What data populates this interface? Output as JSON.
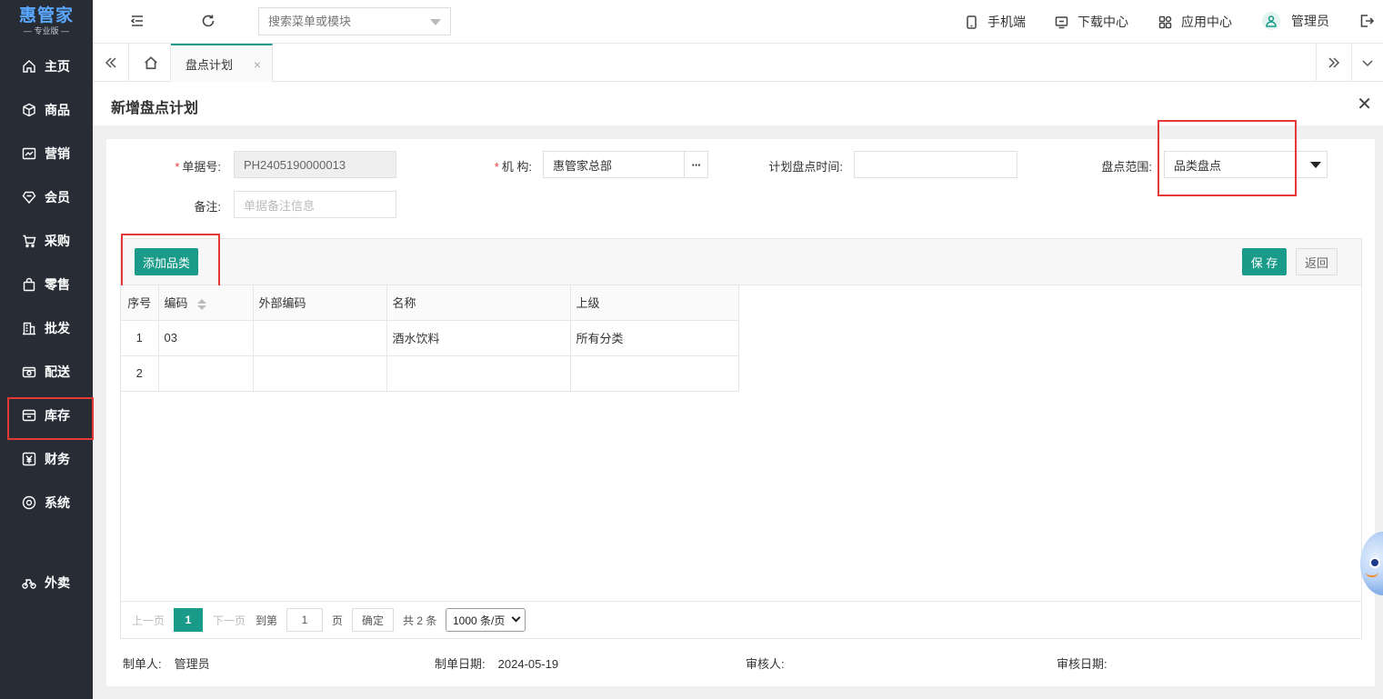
{
  "app": {
    "logo_title": "惠管家",
    "logo_subtitle": "— 专业版 —",
    "accent_color": "#1a9b8a"
  },
  "sidebar": {
    "items": [
      {
        "label": "主页",
        "icon": "home-icon"
      },
      {
        "label": "商品",
        "icon": "box-icon"
      },
      {
        "label": "营销",
        "icon": "chart-icon"
      },
      {
        "label": "会员",
        "icon": "diamond-icon"
      },
      {
        "label": "采购",
        "icon": "cart-icon"
      },
      {
        "label": "零售",
        "icon": "bag-icon"
      },
      {
        "label": "批发",
        "icon": "building-icon"
      },
      {
        "label": "配送",
        "icon": "truck-icon"
      },
      {
        "label": "库存",
        "icon": "inventory-icon"
      },
      {
        "label": "财务",
        "icon": "yen-icon"
      },
      {
        "label": "系统",
        "icon": "settings-icon"
      },
      {
        "label": "外卖",
        "icon": "bike-icon"
      }
    ],
    "highlighted": "库存"
  },
  "topbar": {
    "search_placeholder": "搜索菜单或模块",
    "mobile_label": "手机端",
    "download_label": "下载中心",
    "apps_label": "应用中心",
    "user_label": "管理员"
  },
  "tabs": {
    "active_label": "盘点计划",
    "close_glyph": "×"
  },
  "page": {
    "title": "新增盘点计划",
    "close_glyph": "✕"
  },
  "form": {
    "required_mark": "*",
    "doc_no_label": "单据号:",
    "doc_no_value": "PH2405190000013",
    "org_label": "机 构:",
    "org_value": "惠管家总部",
    "org_picker_glyph": "···",
    "plan_time_label": "计划盘点时间:",
    "plan_time_value": "",
    "scope_label": "盘点范围:",
    "scope_value": "品类盘点",
    "remark_label": "备注:",
    "remark_placeholder": "单据备注信息"
  },
  "toolbar": {
    "add_category_label": "添加品类",
    "save_label": "保 存",
    "back_label": "返回"
  },
  "table": {
    "columns": [
      "序号",
      "编码",
      "外部编码",
      "名称",
      "上级"
    ],
    "rows": [
      {
        "idx": "1",
        "code": "03",
        "ext_code": "",
        "name": "酒水饮料",
        "parent": "所有分类"
      },
      {
        "idx": "2",
        "code": "",
        "ext_code": "",
        "name": "",
        "parent": ""
      }
    ]
  },
  "pager": {
    "prev_label": "上一页",
    "current_page": "1",
    "next_label": "下一页",
    "goto_label": "到第",
    "goto_value": "1",
    "page_unit": "页",
    "confirm_label": "确定",
    "total_label": "共 2 条",
    "page_size": "1000 条/页"
  },
  "footer": {
    "creator_label": "制单人:",
    "creator_value": "管理员",
    "date_label": "制单日期:",
    "date_value": "2024-05-19",
    "auditor_label": "审核人:",
    "auditor_value": "",
    "audit_date_label": "审核日期:",
    "audit_date_value": ""
  }
}
